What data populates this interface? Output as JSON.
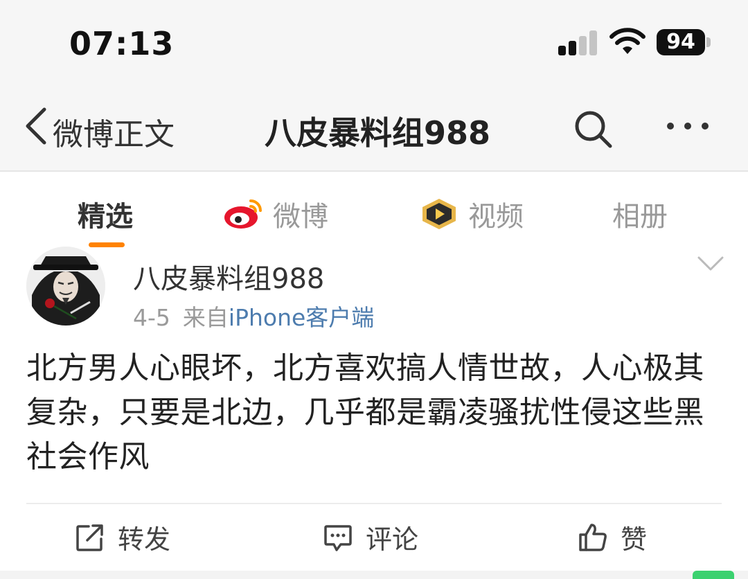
{
  "status_bar": {
    "time": "07:13",
    "battery": "94"
  },
  "nav": {
    "back_label": "微博正文",
    "title": "八皮暴料组988"
  },
  "tabs": [
    {
      "label": "精选",
      "active": true
    },
    {
      "label": "微博",
      "active": false,
      "icon": "weibo-logo-icon"
    },
    {
      "label": "视频",
      "active": false,
      "icon": "video-badge-icon"
    },
    {
      "label": "相册",
      "active": false
    }
  ],
  "post": {
    "author": "八皮暴料组988",
    "date": "4-5",
    "source_prefix": "来自",
    "source": "iPhone客户端",
    "text": "北方男人心眼坏，北方喜欢搞人情世故，人心极其复杂，只要是北边，几乎都是霸凌骚扰性侵这些黑社会作风"
  },
  "actions": {
    "repost": "转发",
    "comment": "评论",
    "like": "赞"
  },
  "colors": {
    "accent": "#ff8200",
    "link": "#4d7cae"
  }
}
